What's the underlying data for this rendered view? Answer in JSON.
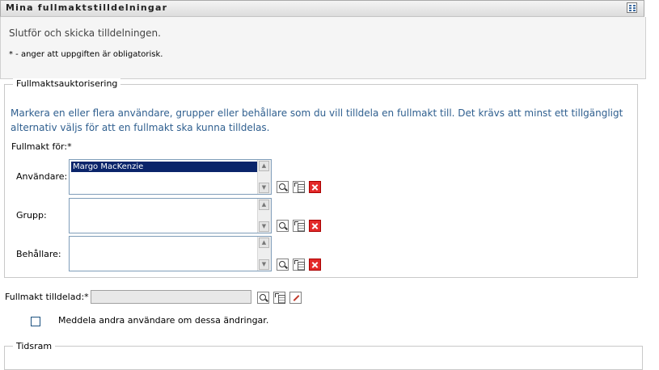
{
  "window": {
    "title": "Mina fullmaktstilldelningar",
    "menu_icon": "layout-menu-icon"
  },
  "header": {
    "subtitle": "Slutför och skicka tilldelningen.",
    "required_note": "* - anger att uppgiften är obligatorisk."
  },
  "authorization": {
    "legend": "Fullmaktsauktorisering",
    "instructions": "Markera en eller flera användare, grupper eller behållare som du vill tilldela en fullmakt till. Det krävs att minst ett tillgängligt alternativ väljs för att en fullmakt ska kunna tilldelas.",
    "proxy_for_label": "Fullmakt för:*",
    "users": {
      "label": "Användare:",
      "items": [
        "Margo MacKenzie"
      ]
    },
    "group": {
      "label": "Grupp:",
      "items": []
    },
    "containers": {
      "label": "Behållare:",
      "items": []
    }
  },
  "assigned": {
    "label": "Fullmakt tilldelad:*",
    "value": ""
  },
  "notify": {
    "label": "Meddela andra användare om dessa ändringar.",
    "checked": false
  },
  "timeframe": {
    "legend": "Tidsram"
  },
  "colors": {
    "instruction_text": "#2f5f8f",
    "selection_bg": "#0a246a",
    "delete_icon": "#e32a2a"
  }
}
